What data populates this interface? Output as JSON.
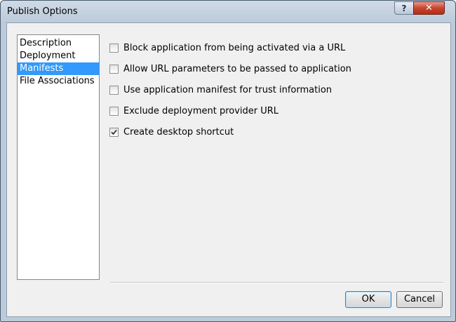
{
  "window": {
    "title": "Publish Options",
    "help_glyph": "?",
    "close_glyph": "✕"
  },
  "sidebar": {
    "items": [
      {
        "label": "Description",
        "selected": false
      },
      {
        "label": "Deployment",
        "selected": false
      },
      {
        "label": "Manifests",
        "selected": true
      },
      {
        "label": "File Associations",
        "selected": false
      }
    ]
  },
  "options": [
    {
      "label": "Block application from being activated via a URL",
      "checked": false
    },
    {
      "label": "Allow URL parameters to be passed to application",
      "checked": false
    },
    {
      "label": "Use application manifest for trust information",
      "checked": false
    },
    {
      "label": "Exclude deployment provider URL",
      "checked": false
    },
    {
      "label": "Create desktop shortcut",
      "checked": true
    }
  ],
  "buttons": {
    "ok": "OK",
    "cancel": "Cancel"
  },
  "colors": {
    "selection": "#3399ff",
    "close_button": "#c6452f"
  }
}
